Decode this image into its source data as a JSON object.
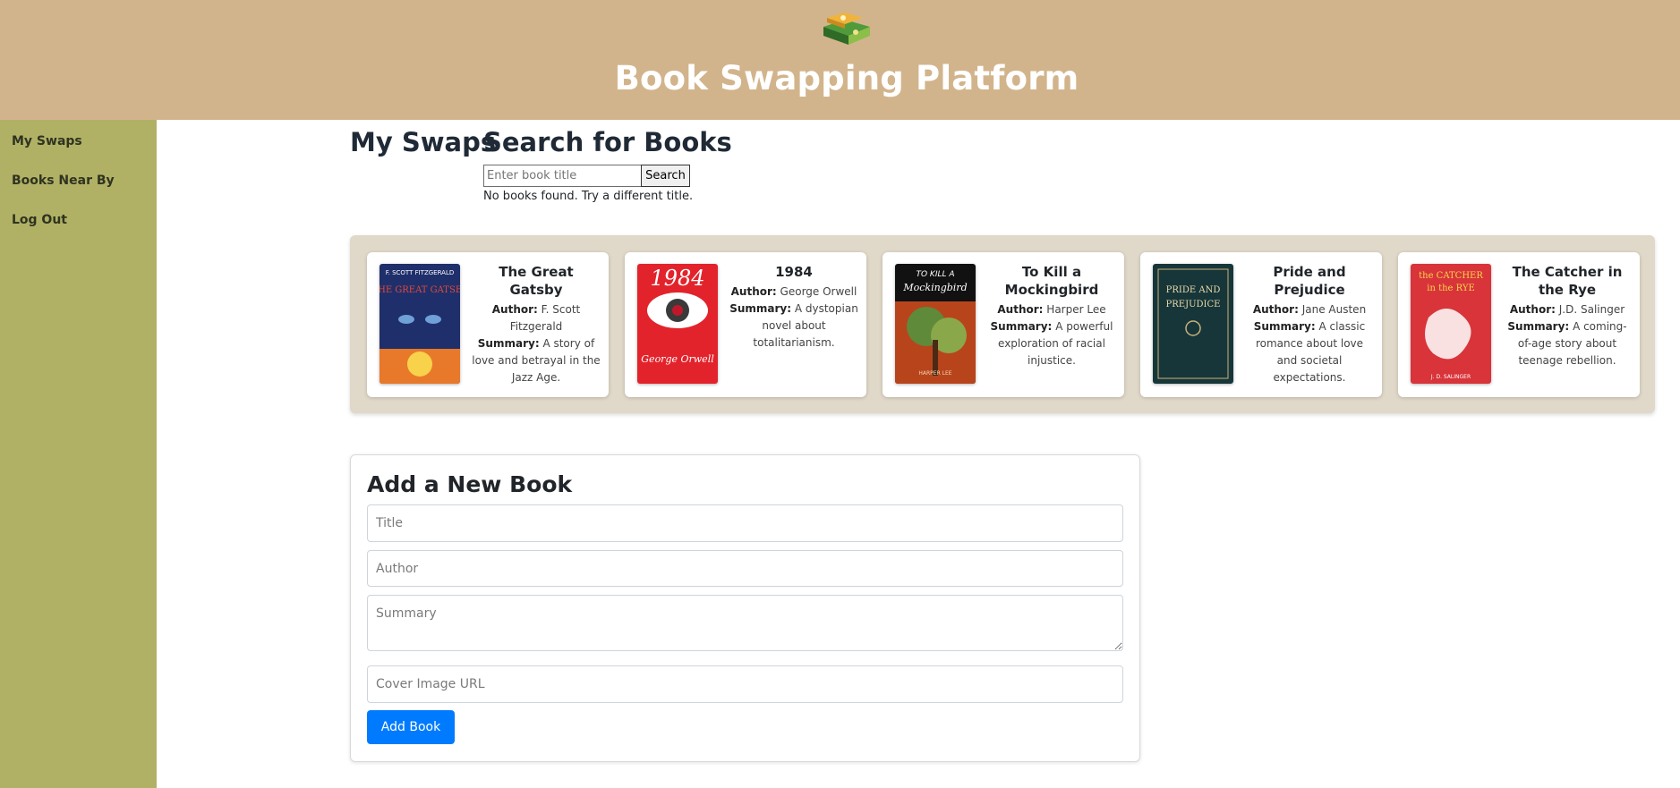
{
  "header": {
    "title": "Book Swapping Platform",
    "logo_icon": "book-swap-logo-icon"
  },
  "sidebar": {
    "items": [
      {
        "label": "My Swaps"
      },
      {
        "label": "Books Near By"
      },
      {
        "label": "Log Out"
      }
    ]
  },
  "main": {
    "swaps_heading": "My Swaps",
    "search_heading": "Search for Books",
    "search": {
      "placeholder": "Enter book title",
      "value": "",
      "button_label": "Search",
      "status": "No books found. Try a different title."
    }
  },
  "labels": {
    "author": "Author:",
    "summary": "Summary:"
  },
  "books": [
    {
      "title": "The Great Gatsby",
      "author": "F. Scott Fitzgerald",
      "summary": "A story of love and betrayal in the Jazz Age.",
      "cover_texts": [
        "F. SCOTT FITZGERALD",
        "THE GREAT GATSBY"
      ]
    },
    {
      "title": "1984",
      "author": "George Orwell",
      "summary": "A dystopian novel about totalitarianism.",
      "cover_texts": [
        "1984",
        "George Orwell"
      ]
    },
    {
      "title": "To Kill a Mockingbird",
      "author": "Harper Lee",
      "summary": "A powerful exploration of racial injustice.",
      "cover_texts": [
        "TO KILL A",
        "Mockingbird",
        "HARPER LEE"
      ]
    },
    {
      "title": "Pride and Prejudice",
      "author": "Jane Austen",
      "summary": "A classic romance about love and societal expectations.",
      "cover_texts": [
        "PRIDE AND",
        "PREJUDICE"
      ]
    },
    {
      "title": "The Catcher in the Rye",
      "author": "J.D. Salinger",
      "summary": "A coming-of-age story about teenage rebellion.",
      "cover_texts": [
        "the CATCHER",
        "in the RYE",
        "J. D. SALINGER"
      ]
    }
  ],
  "form": {
    "heading": "Add a New Book",
    "title_placeholder": "Title",
    "author_placeholder": "Author",
    "summary_placeholder": "Summary",
    "cover_placeholder": "Cover Image URL",
    "submit_label": "Add Book"
  },
  "colors": {
    "header": "#d2b48c",
    "sidebar": "#b0b165",
    "shelf": "#e0d8c8",
    "button": "#007bff"
  }
}
